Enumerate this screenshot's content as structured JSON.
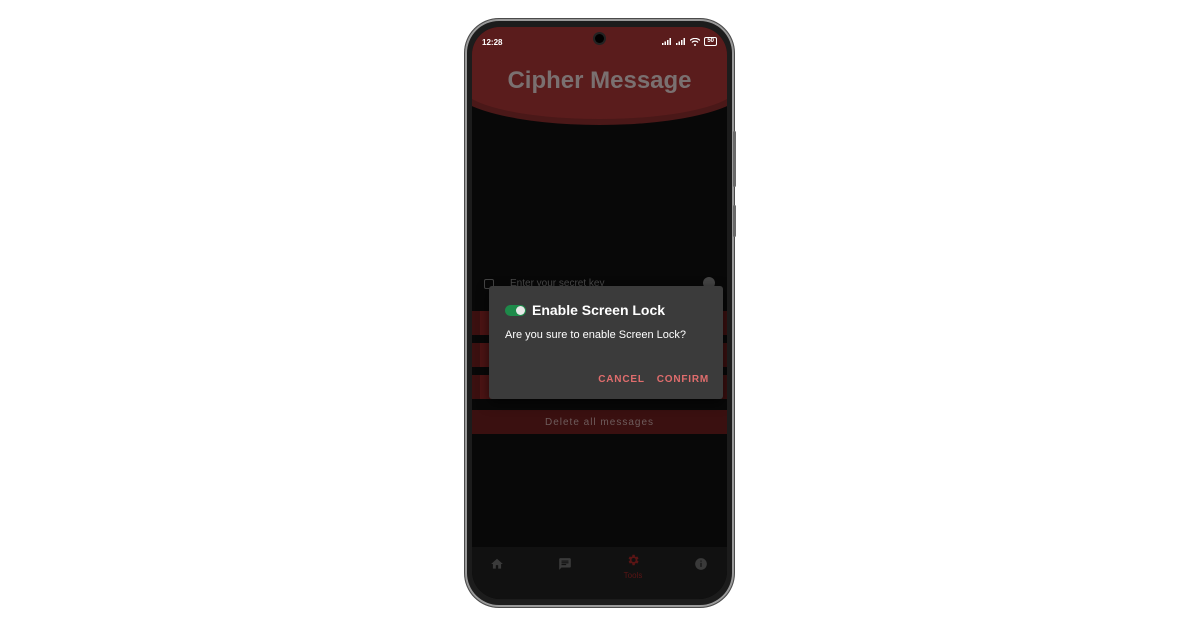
{
  "status_bar": {
    "time": "12:28",
    "battery": "50"
  },
  "app": {
    "title": "Cipher Message"
  },
  "key_input": {
    "placeholder": "Enter your secret key"
  },
  "delete_button": {
    "label": "Delete all messages"
  },
  "nav": {
    "items": [
      {
        "icon": "home-icon",
        "label": ""
      },
      {
        "icon": "message-icon",
        "label": ""
      },
      {
        "icon": "gear-icon",
        "label": "Tools"
      },
      {
        "icon": "info-icon",
        "label": ""
      }
    ]
  },
  "dialog": {
    "title": "Enable Screen Lock",
    "message": "Are you sure to enable Screen Lock?",
    "cancel_label": "CANCEL",
    "confirm_label": "CONFIRM",
    "toggle_on": true
  },
  "colors": {
    "accent": "#e06d6d",
    "header": "#5a1c1c",
    "toggle": "#1e8a4a"
  }
}
